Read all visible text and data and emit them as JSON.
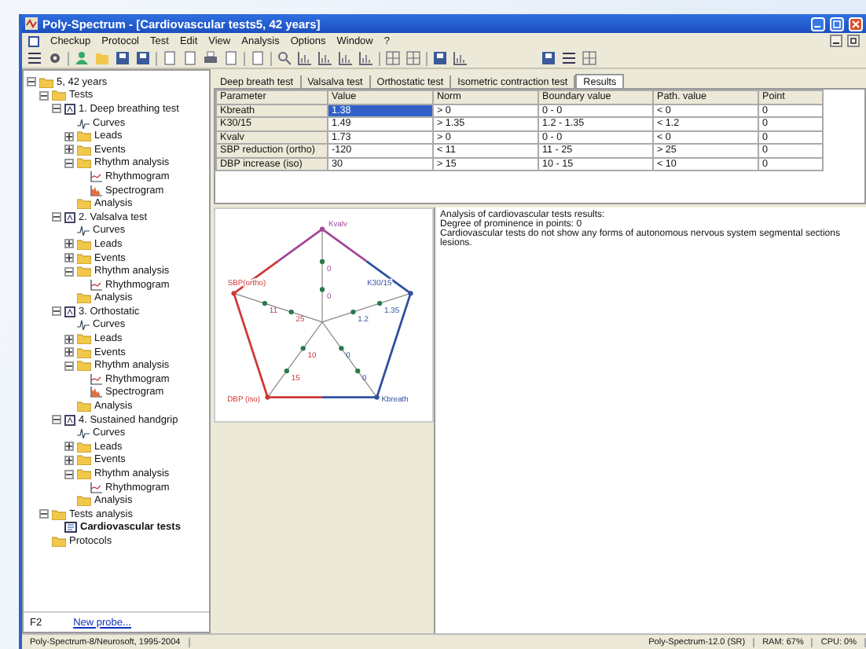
{
  "window": {
    "title": "Poly-Spectrum - [Cardiovascular tests5, 42 years]"
  },
  "menu": [
    "Checkup",
    "Protocol",
    "Test",
    "Edit",
    "View",
    "Analysis",
    "Options",
    "Window",
    "?"
  ],
  "tree": [
    {
      "label": "5, 42 years",
      "kind": "folder",
      "expanded": true,
      "selected": false,
      "children": [
        {
          "label": "Tests",
          "kind": "folder",
          "expanded": true,
          "selected": false,
          "children": [
            {
              "label": "1. Deep breathing test",
              "kind": "test",
              "expanded": true,
              "selected": false,
              "children": [
                {
                  "label": "Curves",
                  "kind": "curves",
                  "selected": false
                },
                {
                  "label": "Leads",
                  "kind": "folder",
                  "expanded": false,
                  "selected": false
                },
                {
                  "label": "Events",
                  "kind": "folder",
                  "expanded": false,
                  "selected": false
                },
                {
                  "label": "Rhythm analysis",
                  "kind": "folder",
                  "expanded": true,
                  "selected": false,
                  "children": [
                    {
                      "label": "Rhythmogram",
                      "kind": "rhythmogram",
                      "selected": false
                    },
                    {
                      "label": "Spectrogram",
                      "kind": "spectrogram",
                      "selected": false
                    }
                  ]
                },
                {
                  "label": "Analysis",
                  "kind": "folder",
                  "selected": false
                }
              ]
            },
            {
              "label": "2. Valsalva test",
              "kind": "test",
              "expanded": true,
              "selected": false,
              "children": [
                {
                  "label": "Curves",
                  "kind": "curves",
                  "selected": false
                },
                {
                  "label": "Leads",
                  "kind": "folder",
                  "expanded": false,
                  "selected": false
                },
                {
                  "label": "Events",
                  "kind": "folder",
                  "expanded": false,
                  "selected": false
                },
                {
                  "label": "Rhythm analysis",
                  "kind": "folder",
                  "expanded": true,
                  "selected": false,
                  "children": [
                    {
                      "label": "Rhythmogram",
                      "kind": "rhythmogram",
                      "selected": false
                    }
                  ]
                },
                {
                  "label": "Analysis",
                  "kind": "folder",
                  "selected": false
                }
              ]
            },
            {
              "label": "3. Orthostatic",
              "kind": "test",
              "expanded": true,
              "selected": false,
              "children": [
                {
                  "label": "Curves",
                  "kind": "curves",
                  "selected": false
                },
                {
                  "label": "Leads",
                  "kind": "folder",
                  "expanded": false,
                  "selected": false
                },
                {
                  "label": "Events",
                  "kind": "folder",
                  "expanded": false,
                  "selected": false
                },
                {
                  "label": "Rhythm analysis",
                  "kind": "folder",
                  "expanded": true,
                  "selected": false,
                  "children": [
                    {
                      "label": "Rhythmogram",
                      "kind": "rhythmogram",
                      "selected": false
                    },
                    {
                      "label": "Spectrogram",
                      "kind": "spectrogram",
                      "selected": false
                    }
                  ]
                },
                {
                  "label": "Analysis",
                  "kind": "folder",
                  "selected": false
                }
              ]
            },
            {
              "label": "4. Sustained handgrip",
              "kind": "test",
              "expanded": true,
              "selected": false,
              "children": [
                {
                  "label": "Curves",
                  "kind": "curves",
                  "selected": false
                },
                {
                  "label": "Leads",
                  "kind": "folder",
                  "expanded": false,
                  "selected": false
                },
                {
                  "label": "Events",
                  "kind": "folder",
                  "expanded": false,
                  "selected": false
                },
                {
                  "label": "Rhythm analysis",
                  "kind": "folder",
                  "expanded": true,
                  "selected": false,
                  "children": [
                    {
                      "label": "Rhythmogram",
                      "kind": "rhythmogram",
                      "selected": false
                    }
                  ]
                },
                {
                  "label": "Analysis",
                  "kind": "folder",
                  "selected": false
                }
              ]
            }
          ]
        },
        {
          "label": "Tests analysis",
          "kind": "folder",
          "expanded": true,
          "selected": false,
          "children": [
            {
              "label": "Cardiovascular tests",
              "kind": "report",
              "selected": true
            }
          ]
        },
        {
          "label": "Protocols",
          "kind": "folder",
          "selected": false
        }
      ]
    }
  ],
  "left_footer": {
    "key": "F2",
    "link": "New probe..."
  },
  "tabs": [
    {
      "label": "Deep breath test",
      "selected": false
    },
    {
      "label": "Valsalva test",
      "selected": false
    },
    {
      "label": "Orthostatic test",
      "selected": false
    },
    {
      "label": "Isometric contraction test",
      "selected": false
    },
    {
      "label": "Results",
      "selected": true
    }
  ],
  "table": {
    "columns": [
      "Parameter",
      "Value",
      "Norm",
      "Boundary value",
      "Path. value",
      "Point"
    ],
    "rows": [
      {
        "cells": [
          "Kbreath",
          "1.38",
          "> 0",
          "0 - 0",
          "< 0",
          "0"
        ],
        "selected": true
      },
      {
        "cells": [
          "K30/15",
          "1.49",
          "> 1.35",
          "1.2 - 1.35",
          "< 1.2",
          "0"
        ],
        "selected": false
      },
      {
        "cells": [
          "Kvalv",
          "1.73",
          "> 0",
          "0 - 0",
          "< 0",
          "0"
        ],
        "selected": false
      },
      {
        "cells": [
          "SBP reduction (ortho)",
          "-120",
          "< 11",
          "11 - 25",
          "> 25",
          "0"
        ],
        "selected": false
      },
      {
        "cells": [
          "DBP increase (iso)",
          "30",
          "> 15",
          "10 - 15",
          "< 10",
          "0"
        ],
        "selected": false
      }
    ]
  },
  "radar": {
    "axes": [
      {
        "label": "Kvalv",
        "color": "#a04898",
        "ticks": [
          "0",
          "0"
        ]
      },
      {
        "label": "SBP(ortho)",
        "color": "#d03838",
        "ticks": [
          "11",
          "25"
        ]
      },
      {
        "label": "K30/15",
        "color": "#3050a0",
        "ticks": [
          "1.2",
          "1.35"
        ]
      },
      {
        "label": "DBP (iso)",
        "color": "#d03838",
        "ticks": [
          "10",
          "15"
        ]
      },
      {
        "label": "Kbreath",
        "color": "#3050a0",
        "ticks": [
          "0",
          "0"
        ]
      }
    ]
  },
  "results_text": [
    "Analysis of cardiovascular tests results:",
    "Degree of prominence in points: 0",
    "Cardiovascular tests do not show any forms of autonomous nervous system segmental sections lesions."
  ],
  "status_bar": {
    "left": "Poly-Spectrum-8/Neurosoft, 1995-2004",
    "product": "Poly-Spectrum-12.0 (SR)",
    "ram": "RAM: 67%",
    "cpu": "CPU: 0%"
  }
}
